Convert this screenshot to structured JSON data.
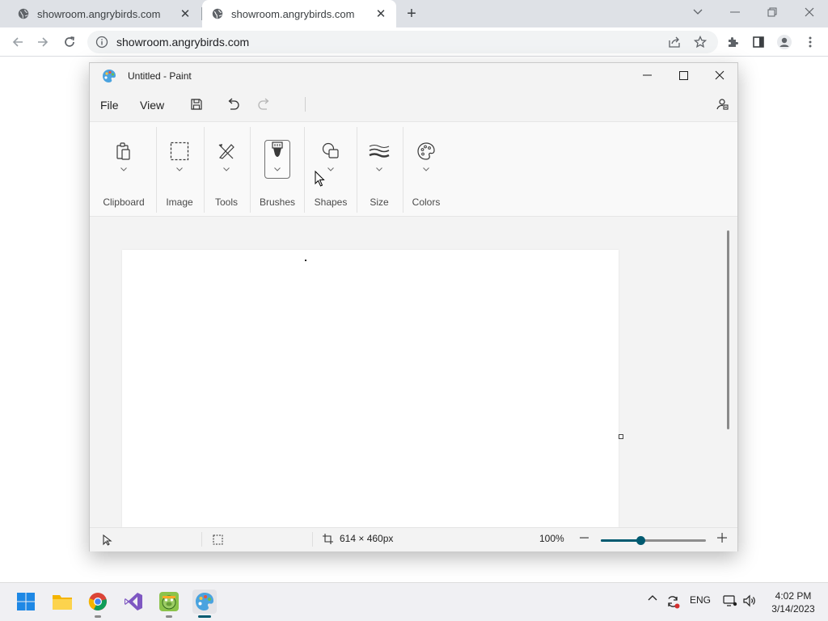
{
  "browser": {
    "tabs": [
      {
        "title": "showroom.angrybirds.com",
        "active": false
      },
      {
        "title": "showroom.angrybirds.com",
        "active": true
      }
    ],
    "new_tab_label": "+",
    "address": "showroom.angrybirds.com",
    "icons": [
      "globe-icon",
      "close-icon",
      "back-icon",
      "forward-icon",
      "reload-icon",
      "info-icon",
      "share-icon",
      "star-icon",
      "extensions-icon",
      "side-panel-icon",
      "profile-icon",
      "menu-icon"
    ]
  },
  "paint": {
    "title": "Untitled - Paint",
    "menu": {
      "file": "File",
      "view": "View"
    },
    "ribbon": {
      "groups": [
        {
          "label": "Clipboard",
          "icon": "clipboard-icon"
        },
        {
          "label": "Image",
          "icon": "selection-icon"
        },
        {
          "label": "Tools",
          "icon": "tools-icon"
        },
        {
          "label": "Brushes",
          "icon": "brush-icon"
        },
        {
          "label": "Shapes",
          "icon": "shapes-icon"
        },
        {
          "label": "Size",
          "icon": "size-icon"
        },
        {
          "label": "Colors",
          "icon": "palette-icon"
        }
      ]
    },
    "status": {
      "canvas_size": "614 × 460px",
      "zoom": "100%",
      "zoom_level": 0.38
    }
  },
  "taskbar": {
    "apps": [
      "start-icon",
      "file-explorer-icon",
      "chrome-icon",
      "visual-studio-icon",
      "angry-birds-icon",
      "paint-icon"
    ],
    "language": "ENG",
    "time": "4:02 PM",
    "date": "3/14/2023"
  },
  "colors": {
    "accent": "#005a70",
    "chrome_bg": "#dee1e6",
    "paint_bg": "#f3f3f3"
  }
}
